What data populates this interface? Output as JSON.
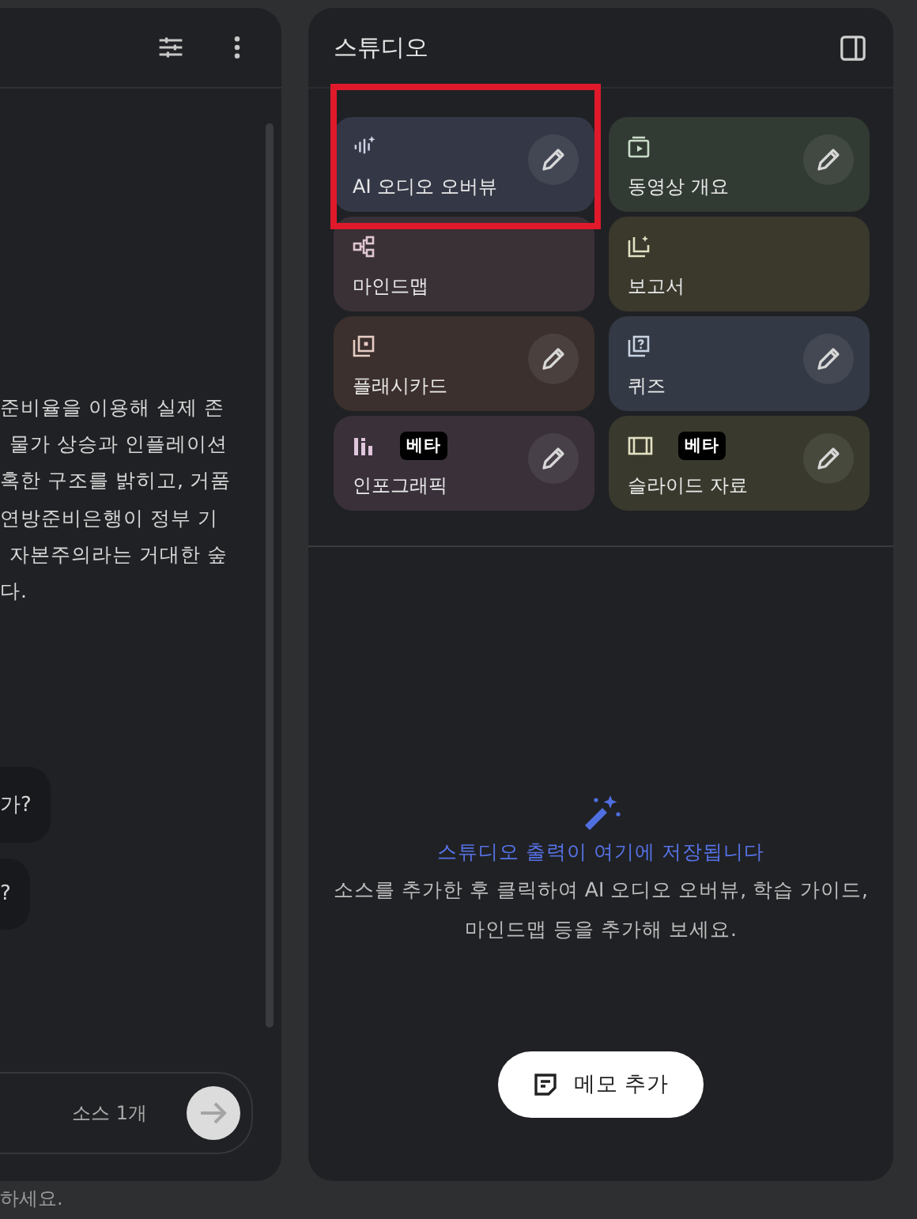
{
  "chat": {
    "summary_lines": [
      "준비율을 이용해 실제 존",
      "물가 상승과 인플레이션",
      "혹한 구조를 밝히고, 거품",
      "연방준비은행이 정부 기",
      "자본주의라는 거대한 숲",
      "다."
    ],
    "questions": [
      "가?",
      "?"
    ],
    "input": {
      "source_count": "소스 1개"
    },
    "footer": "하세요."
  },
  "studio": {
    "title": "스튜디오",
    "cards": [
      {
        "kind": "audio",
        "label": "AI 오디오 오버뷰",
        "color": "#343846",
        "editable": true,
        "highlighted": true
      },
      {
        "kind": "video",
        "label": "동영상 개요",
        "color": "#323a34",
        "editable": true,
        "highlighted": false
      },
      {
        "kind": "mindmap",
        "label": "마인드맵",
        "color": "#3a3137",
        "editable": false,
        "highlighted": false
      },
      {
        "kind": "report",
        "label": "보고서",
        "color": "#3a392c",
        "editable": false,
        "highlighted": false
      },
      {
        "kind": "flashcard",
        "label": "플래시카드",
        "color": "#3b302d",
        "editable": true,
        "highlighted": false
      },
      {
        "kind": "quiz",
        "label": "퀴즈",
        "color": "#333945",
        "editable": true,
        "highlighted": false
      },
      {
        "kind": "infographic",
        "label": "인포그래픽",
        "color": "#393039",
        "editable": true,
        "badge": "베타",
        "highlighted": false
      },
      {
        "kind": "slides",
        "label": "슬라이드 자료",
        "color": "#393a2d",
        "editable": true,
        "badge": "베타",
        "highlighted": false
      }
    ],
    "empty_title": "스튜디오 출력이 여기에 저장됩니다",
    "empty_text": "소스를 추가한 후 클릭하여 AI 오디오 오버뷰, 학습 가이드, 마인드맵 등을 추가해 보세요.",
    "note_button": "메모 추가"
  }
}
